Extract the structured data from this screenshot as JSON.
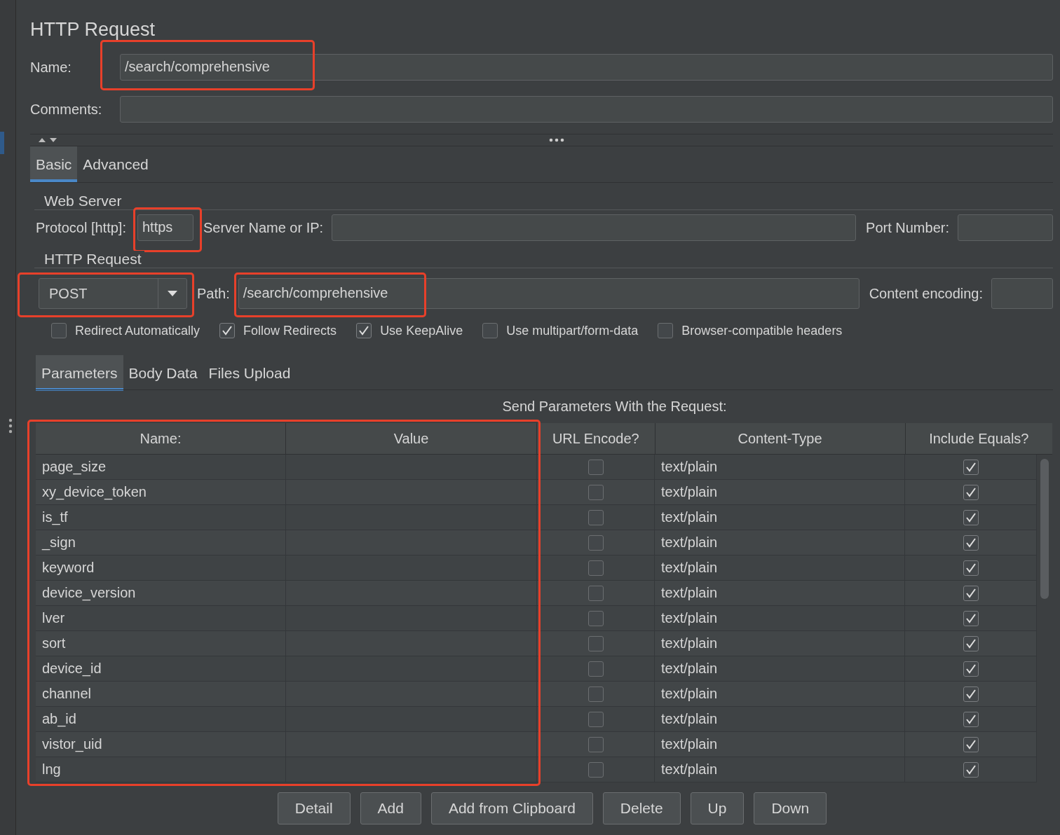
{
  "title": "HTTP Request",
  "name_field": {
    "label": "Name:",
    "value": "/search/comprehensive"
  },
  "comments_field": {
    "label": "Comments:"
  },
  "tabs": [
    {
      "label": "Basic",
      "selected": true
    },
    {
      "label": "Advanced",
      "selected": false
    }
  ],
  "web_server": {
    "legend": "Web Server",
    "protocol_label": "Protocol [http]:",
    "protocol": "https",
    "server_label": "Server Name or IP:",
    "port_label": "Port Number:"
  },
  "http_request": {
    "legend": "HTTP Request",
    "method": "POST",
    "path_label": "Path:",
    "path": "/search/comprehensive",
    "encoding_label": "Content encoding:"
  },
  "options": [
    {
      "label": "Redirect Automatically",
      "checked": false
    },
    {
      "label": "Follow Redirects",
      "checked": true
    },
    {
      "label": "Use KeepAlive",
      "checked": true
    },
    {
      "label": "Use multipart/form-data",
      "checked": false
    },
    {
      "label": "Browser-compatible headers",
      "checked": false
    }
  ],
  "subtabs": [
    {
      "label": "Parameters",
      "selected": true
    },
    {
      "label": "Body Data",
      "selected": false
    },
    {
      "label": "Files Upload",
      "selected": false
    }
  ],
  "table": {
    "caption": "Send Parameters With the Request:",
    "columns": [
      "Name:",
      "Value",
      "URL Encode?",
      "Content-Type",
      "Include Equals?"
    ],
    "rows": [
      {
        "name": "page_size",
        "url_encode": false,
        "content_type": "text/plain",
        "include_equals": true
      },
      {
        "name": "xy_device_token",
        "url_encode": false,
        "content_type": "text/plain",
        "include_equals": true
      },
      {
        "name": "is_tf",
        "url_encode": false,
        "content_type": "text/plain",
        "include_equals": true
      },
      {
        "name": "_sign",
        "url_encode": false,
        "content_type": "text/plain",
        "include_equals": true
      },
      {
        "name": "keyword",
        "url_encode": false,
        "content_type": "text/plain",
        "include_equals": true
      },
      {
        "name": "device_version",
        "url_encode": false,
        "content_type": "text/plain",
        "include_equals": true
      },
      {
        "name": "lver",
        "url_encode": false,
        "content_type": "text/plain",
        "include_equals": true
      },
      {
        "name": "sort",
        "url_encode": false,
        "content_type": "text/plain",
        "include_equals": true
      },
      {
        "name": "device_id",
        "url_encode": false,
        "content_type": "text/plain",
        "include_equals": true
      },
      {
        "name": "channel",
        "url_encode": false,
        "content_type": "text/plain",
        "include_equals": true
      },
      {
        "name": "ab_id",
        "url_encode": false,
        "content_type": "text/plain",
        "include_equals": true
      },
      {
        "name": "vistor_uid",
        "url_encode": false,
        "content_type": "text/plain",
        "include_equals": true
      },
      {
        "name": "lng",
        "url_encode": false,
        "content_type": "text/plain",
        "include_equals": true
      }
    ]
  },
  "buttons": [
    "Detail",
    "Add",
    "Add from Clipboard",
    "Delete",
    "Up",
    "Down"
  ]
}
